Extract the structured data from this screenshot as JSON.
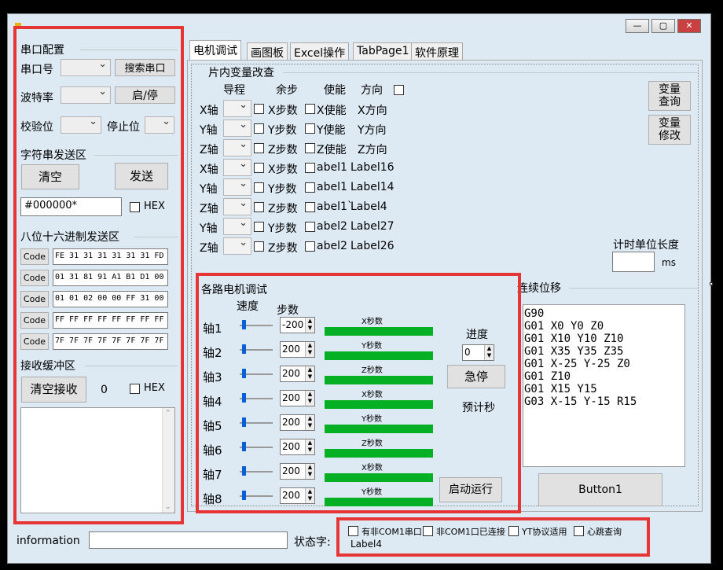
{
  "window": {
    "minimize": "—",
    "maximize": "▢",
    "close": "✕"
  },
  "serial": {
    "title": "串口配置",
    "port_label": "串口号",
    "search_btn": "搜索串口",
    "baud_label": "波特率",
    "startstop_btn": "启/停",
    "parity_label": "校验位",
    "stopbit_label": "停止位"
  },
  "string_send": {
    "title": "字符串发送区",
    "clear_btn": "清空",
    "send_btn": "发送",
    "input_value": "#000000*",
    "hex_label": "HEX"
  },
  "hex_send": {
    "title": "八位十六进制发送区",
    "rows": [
      {
        "btn": "Code",
        "value": "FE 31 31 31 31 31 31 FD"
      },
      {
        "btn": "Code",
        "value": "01 31 81 91 A1 B1 D1 00"
      },
      {
        "btn": "Code",
        "value": "01 01 02 00 00 FF 31 00"
      },
      {
        "btn": "Code",
        "value": "FF FF FF FF FF FF FF FF"
      },
      {
        "btn": "Code",
        "value": "7F 7F 7F 7F 7F 7F 7F 7F"
      }
    ]
  },
  "receive": {
    "title": "接收缓冲区",
    "clear_btn": "清空接收",
    "count": "0",
    "hex_label": "HEX"
  },
  "tabs": [
    "电机调试",
    "画图板",
    "Excel操作",
    "TabPage1",
    "软件原理"
  ],
  "vars": {
    "title": "片内变量改查",
    "headers": {
      "lead": "导程",
      "rem": "余步",
      "enable": "使能",
      "dir": "方向"
    },
    "rows": [
      {
        "axis": "X轴",
        "steps": "X步数",
        "en": "X使能",
        "dir": "X方向"
      },
      {
        "axis": "Y轴",
        "steps": "Y步数",
        "en": "Y使能",
        "dir": "Y方向"
      },
      {
        "axis": "Z轴",
        "steps": "Z步数",
        "en": "Z使能",
        "dir": "Z方向"
      },
      {
        "axis": "X轴",
        "steps": "X步数",
        "en": "abel1",
        "dir": "Label16"
      },
      {
        "axis": "Y轴",
        "steps": "Y步数",
        "en": "abel1",
        "dir": "Label14"
      },
      {
        "axis": "Z轴",
        "steps": "Z步数",
        "en": "abel1`",
        "dir": "Label4"
      },
      {
        "axis": "Y轴",
        "steps": "Y步数",
        "en": "abel2",
        "dir": "Label27"
      },
      {
        "axis": "Z轴",
        "steps": "Z步数",
        "en": "abel2",
        "dir": "Label26"
      }
    ],
    "query_btn": [
      "变量",
      "查询"
    ],
    "modify_btn": [
      "变量",
      "修改"
    ],
    "timer_label": "计时单位长度",
    "timer_unit": "ms"
  },
  "motors": {
    "title": "各路电机调试",
    "speed_hdr": "速度",
    "steps_hdr": "步数",
    "rows": [
      {
        "name": "轴1",
        "steps": "-200",
        "bar": "X秒数",
        "level": 0.1
      },
      {
        "name": "轴2",
        "steps": "200",
        "bar": "Y秒数",
        "level": 0.1
      },
      {
        "name": "轴3",
        "steps": "200",
        "bar": "Z秒数",
        "level": 0.1
      },
      {
        "name": "轴4",
        "steps": "200",
        "bar": "X秒数",
        "level": 0.1
      },
      {
        "name": "轴5",
        "steps": "200",
        "bar": "Y秒数",
        "level": 0.1
      },
      {
        "name": "轴6",
        "steps": "200",
        "bar": "Z秒数",
        "level": 0.1
      },
      {
        "name": "轴7",
        "steps": "200",
        "bar": "X秒数",
        "level": 0.1
      },
      {
        "name": "轴8",
        "steps": "200",
        "bar": "Y秒数",
        "level": 0.1
      }
    ],
    "progress_label": "进度",
    "progress_value": "0",
    "estop_btn": "急停",
    "eta_label": "预计秒",
    "start_btn": "启动运行"
  },
  "continuous": {
    "title": "连续位移",
    "lines": [
      "G90",
      "G01 X0 Y0 Z0",
      "G01 X10 Y10 Z10",
      "G01 X35 Y35 Z35",
      "G01 X-25 Y-25 Z0",
      "G01 Z10",
      "G01 X15 Y15",
      "G03 X-15 Y-15 R15"
    ],
    "button": "Button1"
  },
  "status": {
    "info_label": "information",
    "status_label": "状态字:",
    "checks": [
      "有非COM1串口",
      "非COM1口已连接",
      "YT协议适用",
      "心跳查询"
    ],
    "label4": "Label4"
  }
}
